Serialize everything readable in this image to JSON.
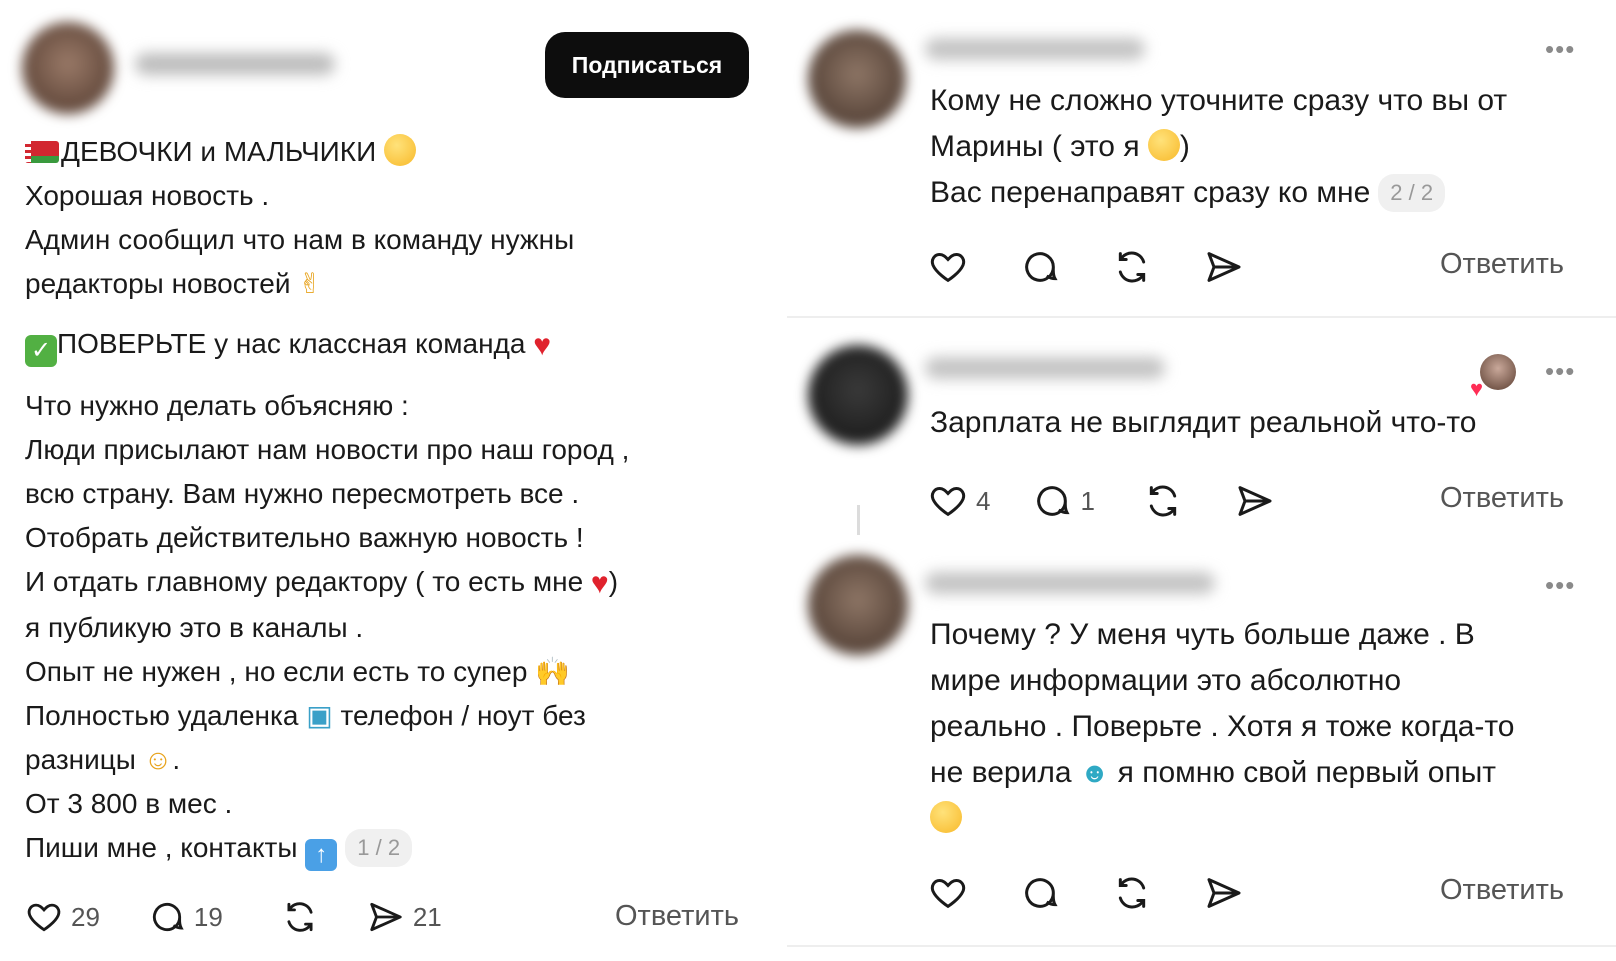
{
  "colors": {
    "button_bg": "#0d0d0d",
    "text": "#1a1a1a",
    "muted": "#555555",
    "heart": "#e0222d"
  },
  "left_post": {
    "subscribe_label": "Подписаться",
    "lines": {
      "l1": "ДЕВОЧКИ и МАЛЬЧИКИ",
      "l2": "Хорошая новость .",
      "l3": "Админ сообщил что нам в команду нужны",
      "l4": "редакторы новостей",
      "l5": "ПОВЕРЬТЕ у нас классная команда",
      "l6": "Что нужно делать объясняю :",
      "l7": "Люди присылают нам новости про наш город ,",
      "l8": "всю страну. Вам нужно пересмотреть все .",
      "l9": "Отобрать действительно важную новость !",
      "l10": "И отдать главному редактору ( то есть мне",
      "l10_end": ")",
      "l11": "я публикую это в каналы .",
      "l12": "Опыт не нужен , но если есть то супер",
      "l13a": "Полностью удаленка",
      "l13b": "телефон / ноут без",
      "l14": "разницы",
      "l14_end": ".",
      "l15": "От 3 800 в мес .",
      "l16": "Пиши мне , контакты"
    },
    "page_pill": "1 / 2",
    "likes": "29",
    "comments": "19",
    "shares": "21",
    "reply_label": "Ответить"
  },
  "comments": [
    {
      "lines": [
        "Кому не сложно уточните сразу что вы от",
        "Марины ( это я",
        ")",
        "Вас перенаправят сразу ко мне"
      ],
      "page_pill": "2 / 2",
      "reply_label": "Ответить",
      "more": "•••"
    },
    {
      "lines": [
        "Зарплата не выглядит реальной что-то"
      ],
      "likes": "4",
      "comments": "1",
      "reply_label": "Ответить",
      "more": "•••"
    },
    {
      "lines": [
        "Почему ? У меня чуть больше даже .  В",
        "мире информации это абсолютно",
        "реально . Поверьте . Хотя я тоже когда-то",
        "не верила",
        "я  помню свой первый опыт"
      ],
      "reply_label": "Ответить",
      "more": "•••"
    }
  ]
}
